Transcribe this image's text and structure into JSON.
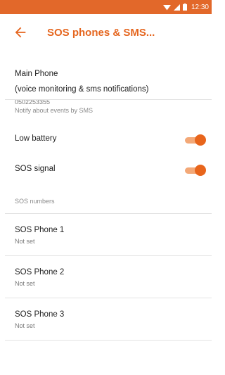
{
  "status_bar": {
    "time": "12:30",
    "background": "#e2682a",
    "icons": [
      "wifi-icon",
      "signal-icon",
      "battery-icon"
    ]
  },
  "toolbar": {
    "title": "SOS phones & SMS...",
    "back_icon": "arrow-back-icon",
    "accent": "#e5661f"
  },
  "main_phone": {
    "title": "Main Phone",
    "subtitle": "(voice monitoring & sms notifications)",
    "number": "0502253355"
  },
  "notify_section": {
    "header": "Notify about events by SMS",
    "toggles": [
      {
        "label": "Low battery",
        "on": true
      },
      {
        "label": "SOS signal",
        "on": true
      }
    ]
  },
  "sos_section": {
    "header": "SOS numbers",
    "phones": [
      {
        "title": "SOS Phone 1",
        "value": "Not set"
      },
      {
        "title": "SOS Phone 2",
        "value": "Not set"
      },
      {
        "title": "SOS Phone 3",
        "value": "Not set"
      }
    ]
  },
  "colors": {
    "switch_track": "#f3a877",
    "switch_thumb": "#e8651c",
    "divider": "#e3e3e3"
  }
}
